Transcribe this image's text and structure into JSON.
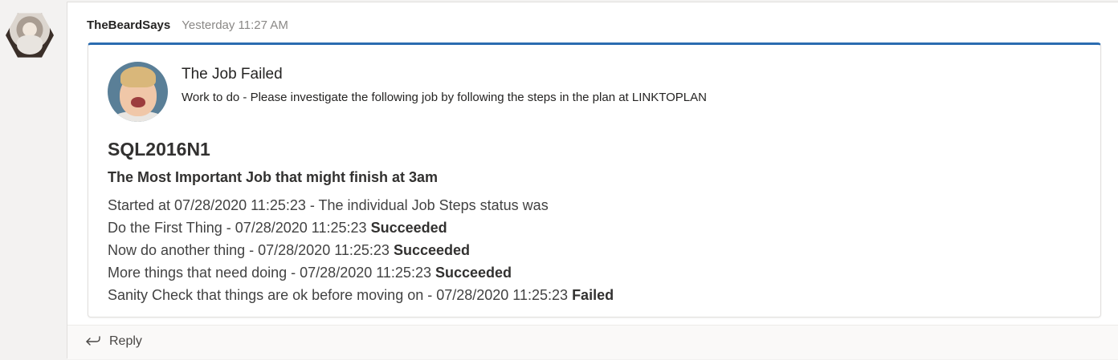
{
  "message": {
    "author": "TheBeardSays",
    "timestamp": "Yesterday 11:27 AM"
  },
  "card": {
    "title": "The Job Failed",
    "subtitle": "Work to do - Please investigate the following job by following the steps in the plan at LINKTOPLAN",
    "server": "SQL2016N1",
    "job_name": "The Most Important Job that might finish at 3am",
    "started": "Started at 07/28/2020 11:25:23 - The individual Job Steps status was",
    "steps": [
      {
        "text": "Do the First Thing - 07/28/2020 11:25:23",
        "status": "Succeeded"
      },
      {
        "text": "Now do another thing - 07/28/2020 11:25:23",
        "status": "Succeeded"
      },
      {
        "text": "More things that need doing - 07/28/2020 11:25:23",
        "status": "Succeeded"
      },
      {
        "text": "Sanity Check that things are ok before moving on - 07/28/2020 11:25:23",
        "status": "Failed"
      }
    ]
  },
  "reply": {
    "label": "Reply",
    "icon": "reply-arrow-icon"
  },
  "colors": {
    "accent": "#2b6cb0",
    "timestamp": "#8a8886",
    "background": "#f3f2f1"
  }
}
